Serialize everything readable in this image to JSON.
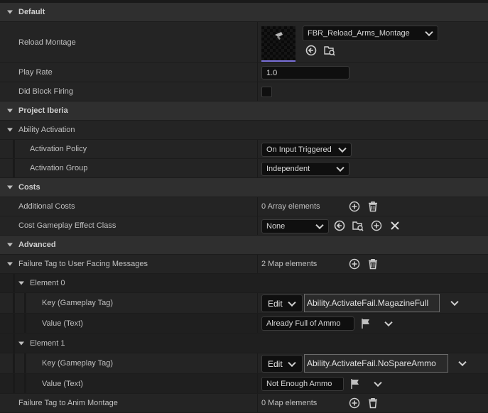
{
  "sections": {
    "default": "Default",
    "project_iberia": "Project Iberia",
    "ability_activation": "Ability Activation",
    "costs": "Costs",
    "advanced": "Advanced"
  },
  "reload_montage": {
    "label": "Reload Montage",
    "value": "FBR_Reload_Arms_Montage"
  },
  "play_rate": {
    "label": "Play Rate",
    "value": "1.0"
  },
  "did_block_firing": {
    "label": "Did Block Firing",
    "checked": false
  },
  "activation_policy": {
    "label": "Activation Policy",
    "value": "On Input Triggered"
  },
  "activation_group": {
    "label": "Activation Group",
    "value": "Independent"
  },
  "additional_costs": {
    "label": "Additional Costs",
    "value": "0 Array elements"
  },
  "cost_effect_class": {
    "label": "Cost Gameplay Effect Class",
    "value": "None"
  },
  "failure_tag_messages": {
    "label": "Failure Tag to User Facing Messages",
    "value": "2 Map elements",
    "elements": [
      {
        "label": "Element 0",
        "key_label": "Key (Gameplay Tag)",
        "edit": "Edit",
        "tag": "Ability.ActivateFail.MagazineFull",
        "value_label": "Value (Text)",
        "text": "Already Full of Ammo"
      },
      {
        "label": "Element 1",
        "key_label": "Key (Gameplay Tag)",
        "edit": "Edit",
        "tag": "Ability.ActivateFail.NoSpareAmmo",
        "value_label": "Value (Text)",
        "text": "Not Enough Ammo"
      }
    ]
  },
  "failure_tag_anim": {
    "label": "Failure Tag to Anim Montage",
    "value": "0 Map elements"
  },
  "colors": {
    "thumbnail_accent": "#7a70d8",
    "background": "#1a1a1a",
    "category": "#2f2f2f"
  }
}
